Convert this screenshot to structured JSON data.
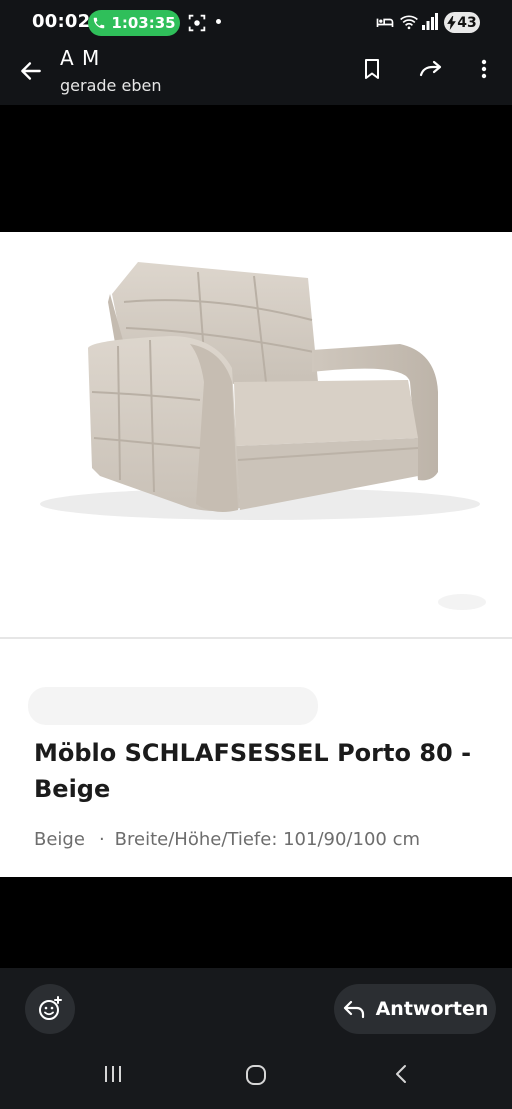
{
  "status_bar": {
    "time": "00:02",
    "call_timer": "1:03:35",
    "battery": "43",
    "icons": [
      "phone-icon",
      "screen-record-icon",
      "do-not-disturb-icon",
      "wifi-icon",
      "signal-icon",
      "battery-icon"
    ],
    "call_color": "#2fbf5a"
  },
  "header": {
    "sender": "A M",
    "subtitle": "gerade eben",
    "icons": [
      "back-arrow-icon",
      "bookmark-icon",
      "forward-icon",
      "more-vertical-icon"
    ]
  },
  "message": {
    "image_description_icon": "armchair-image",
    "title_brand": "Möblo SCHLAFSESSEL",
    "title_rest": " Porto 80 - Beige",
    "color": "Beige",
    "separator": "·",
    "dimensions": "Breite/Höhe/Tiefe: 101/90/100 cm"
  },
  "composer": {
    "reply_label": "Antworten",
    "icons": [
      "emoji-add-icon",
      "reply-icon"
    ]
  },
  "navigation": {
    "icons": [
      "recent-apps-icon",
      "home-icon",
      "back-icon"
    ]
  }
}
